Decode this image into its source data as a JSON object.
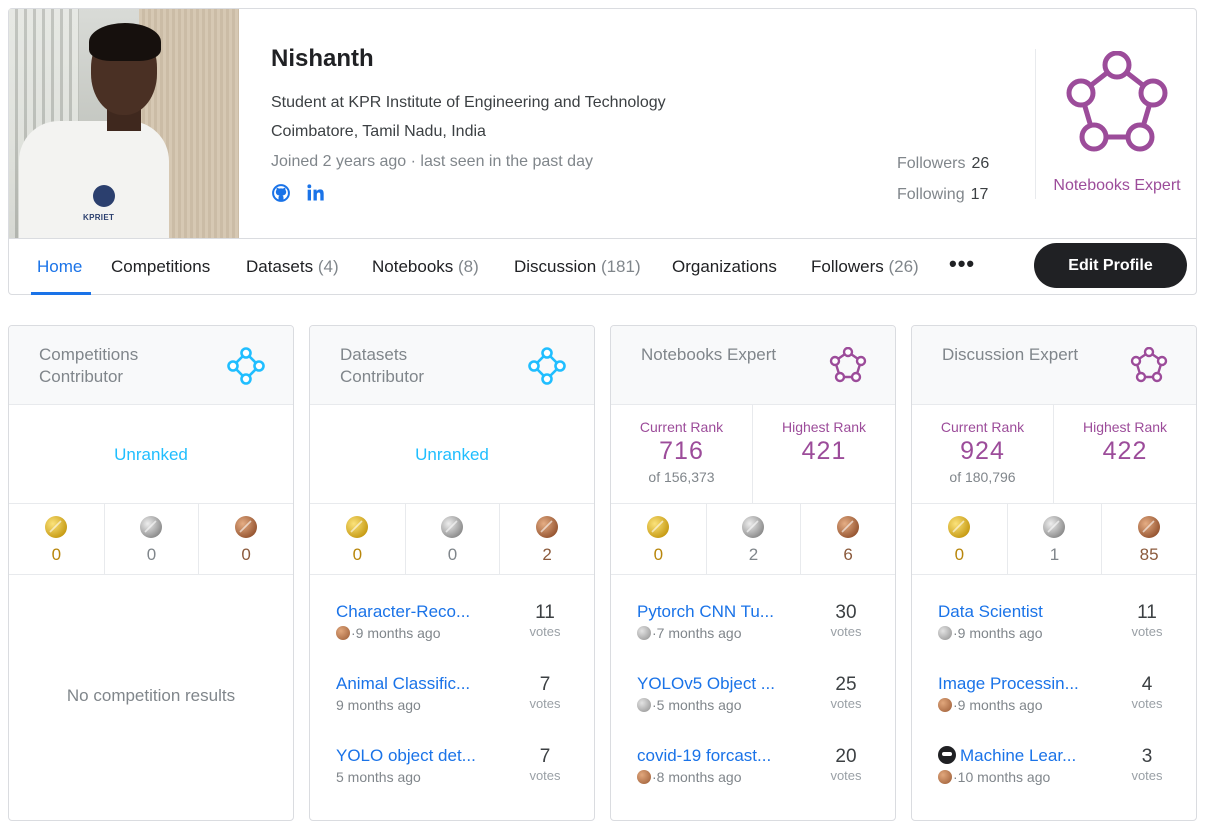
{
  "profile": {
    "name": "Nishanth",
    "bio": "Student at KPR Institute of Engineering and Technology",
    "location": "Coimbatore, Tamil Nadu, India",
    "joined": "Joined 2 years ago · last seen in the past day",
    "avatar_caption": "KPRIET",
    "followers_label": "Followers",
    "followers_count": "26",
    "following_label": "Following",
    "following_count": "17",
    "tier_label": "Notebooks Expert",
    "social_icons": [
      "github-icon",
      "linkedin-icon"
    ]
  },
  "colors": {
    "accent": "#1a73e8",
    "expert": "#9c4c9a",
    "contributor": "#20beff",
    "gold": "#d4a017",
    "silver": "#9e9e9e",
    "bronze": "#b07040"
  },
  "nav": {
    "home": "Home",
    "competitions": "Competitions",
    "datasets": "Datasets",
    "datasets_count": "(4)",
    "notebooks": "Notebooks",
    "notebooks_count": "(8)",
    "discussion": "Discussion",
    "discussion_count": "(181)",
    "organizations": "Organizations",
    "followers": "Followers",
    "followers_count": "(26)",
    "more": "•••",
    "edit_profile": "Edit Profile"
  },
  "cards": {
    "competitions": {
      "title": "Competitions Contributor",
      "rank": "Unranked",
      "medals": {
        "gold": "0",
        "silver": "0",
        "bronze": "0"
      },
      "empty": "No competition results"
    },
    "datasets": {
      "title": "Datasets Contributor",
      "rank": "Unranked",
      "medals": {
        "gold": "0",
        "silver": "0",
        "bronze": "2"
      },
      "items": [
        {
          "title": "Character-Reco...",
          "medal": "bronze",
          "when": "9 months ago",
          "votes": "11",
          "votes_label": "votes"
        },
        {
          "title": "Animal Classific...",
          "medal": "",
          "when": "9 months ago",
          "votes": "7",
          "votes_label": "votes"
        },
        {
          "title": "YOLO object det...",
          "medal": "",
          "when": "5 months ago",
          "votes": "7",
          "votes_label": "votes"
        }
      ]
    },
    "notebooks": {
      "title": "Notebooks Expert",
      "current_rank_label": "Current Rank",
      "current_rank": "716",
      "rank_total": "of 156,373",
      "highest_rank_label": "Highest Rank",
      "highest_rank": "421",
      "medals": {
        "gold": "0",
        "silver": "2",
        "bronze": "6"
      },
      "items": [
        {
          "title": "Pytorch CNN Tu...",
          "medal": "silver",
          "when": "7 months ago",
          "votes": "30",
          "votes_label": "votes"
        },
        {
          "title": "YOLOv5 Object ...",
          "medal": "silver",
          "when": "5 months ago",
          "votes": "25",
          "votes_label": "votes"
        },
        {
          "title": "covid-19 forcast...",
          "medal": "bronze",
          "when": "8 months ago",
          "votes": "20",
          "votes_label": "votes"
        }
      ]
    },
    "discussion": {
      "title": "Discussion Expert",
      "current_rank_label": "Current Rank",
      "current_rank": "924",
      "rank_total": "of 180,796",
      "highest_rank_label": "Highest Rank",
      "highest_rank": "422",
      "medals": {
        "gold": "0",
        "silver": "1",
        "bronze": "85"
      },
      "items": [
        {
          "title": "Data Scientist",
          "medal": "silver",
          "when": "9 months ago",
          "votes": "11",
          "votes_label": "votes"
        },
        {
          "title": "Image Processin...",
          "medal": "bronze",
          "when": "9 months ago",
          "votes": "4",
          "votes_label": "votes"
        },
        {
          "title": "Machine Lear...",
          "medal": "bronze",
          "when": "10 months ago",
          "votes": "3",
          "votes_label": "votes",
          "prefix_icon": "kaggle-emoji-icon"
        }
      ]
    }
  }
}
